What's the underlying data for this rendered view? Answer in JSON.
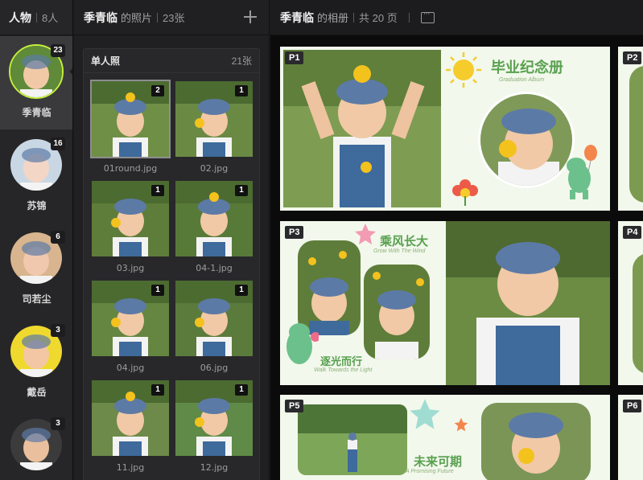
{
  "people_panel": {
    "title": "人物",
    "count": "8人",
    "people": [
      {
        "name": "季青临",
        "count": "23",
        "selected": true,
        "bg": "#5f8a3a",
        "face": "#f1c9a6"
      },
      {
        "name": "苏锦",
        "count": "16",
        "selected": false,
        "bg": "#c9d7e4",
        "face": "#f4d6c6"
      },
      {
        "name": "司若尘",
        "count": "6",
        "selected": false,
        "bg": "#d8b58e",
        "face": "#f0c8ae"
      },
      {
        "name": "戴岳",
        "count": "3",
        "selected": false,
        "bg": "#f0d92e",
        "face": "#f3c7a4"
      },
      {
        "name": "",
        "count": "3",
        "selected": false,
        "bg": "#3b3b3b",
        "face": "#e9bf9d"
      }
    ]
  },
  "photos_panel": {
    "person_name": "季青临",
    "suffix": "的照片",
    "count": "23张",
    "group_title": "单人照",
    "group_count": "21张",
    "photos": [
      {
        "file": "01round.jpg",
        "badge": "2",
        "selected": true
      },
      {
        "file": "02.jpg",
        "badge": "1",
        "selected": false
      },
      {
        "file": "03.jpg",
        "badge": "1",
        "selected": false
      },
      {
        "file": "04-1.jpg",
        "badge": "1",
        "selected": false
      },
      {
        "file": "04.jpg",
        "badge": "1",
        "selected": false
      },
      {
        "file": "06.jpg",
        "badge": "1",
        "selected": false
      },
      {
        "file": "11.jpg",
        "badge": "1",
        "selected": false
      },
      {
        "file": "12.jpg",
        "badge": "1",
        "selected": false
      }
    ]
  },
  "album_panel": {
    "person_name": "季青临",
    "suffix": "的相册",
    "pages": "共 20 页",
    "page_labels": [
      "P1",
      "P2",
      "P3",
      "P4",
      "P5",
      "P6"
    ],
    "p1": {
      "title": "毕业纪念册",
      "subtitle": "Graduation Album"
    },
    "p3": {
      "title": "乘风长大",
      "subtitle": "Grow With The Wind",
      "title2": "逐光而行",
      "subtitle2": "Walk Towards the Light"
    },
    "p5": {
      "title": "未来可期",
      "subtitle": "A Promising Future"
    }
  },
  "colors": {
    "accent": "#c6ef3a",
    "album_green": "#58a04e",
    "grass": "#6f8f3e",
    "cap": "#5c7aa6",
    "overalls": "#3e6a9c"
  }
}
